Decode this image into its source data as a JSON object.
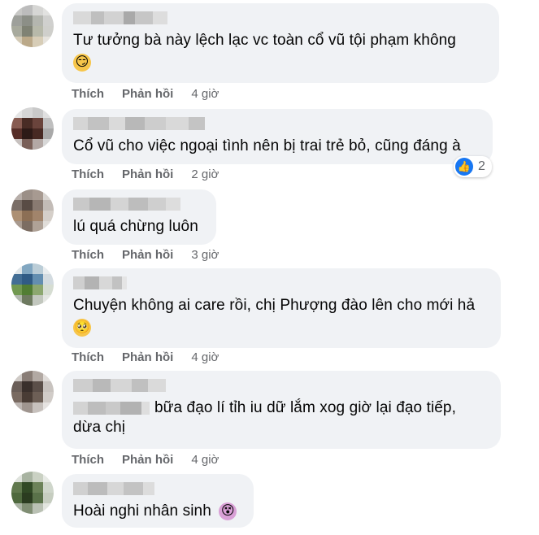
{
  "actions": {
    "like_label": "Thích",
    "reply_label": "Phản hồi"
  },
  "comments": [
    {
      "text": "Tư tưởng bà này lệch lạc vc toàn cổ vũ tội phạm không",
      "emoji": "😏",
      "time": "4 giờ"
    },
    {
      "text": "Cổ vũ cho việc ngoại tình nên bị trai trẻ bỏ, cũng đáng à",
      "time": "2 giờ",
      "reaction_count": "2",
      "reaction_icon": "like-icon"
    },
    {
      "text": "lú quá chừng luôn",
      "time": "3 giờ"
    },
    {
      "text": "Chuyện không ai care rồi, chị Phượng đào lên cho mới hả",
      "emoji": "🥺",
      "time": "4 giờ"
    },
    {
      "text_line1": "bữa đạo lí tỉh iu dữ lắm xog giờ lại đạo tiếp,",
      "text_line2": "dừa chị",
      "time": "4 giờ"
    },
    {
      "text": "Hoài nghi nhân sinh",
      "emoji": "😵",
      "time": ""
    }
  ],
  "colors": {
    "bubble": "#f0f2f5",
    "meta_text": "#65676b",
    "like_blue": "#1877f2",
    "emoji_yellow": "#f7c64a"
  }
}
